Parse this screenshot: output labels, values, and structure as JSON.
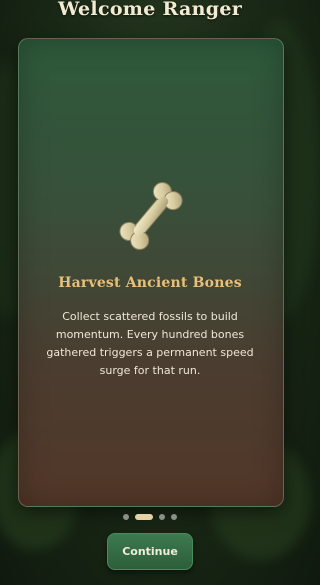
{
  "header": {
    "title": "Welcome Ranger"
  },
  "card": {
    "icon": "bone-icon",
    "title": "Harvest Ancient Bones",
    "description": "Collect scattered fossils to build momentum. Every hundred bones gathered triggers a permanent speed surge for that run."
  },
  "pagination": {
    "total": 4,
    "active_index": 1
  },
  "actions": {
    "continue_label": "Continue"
  },
  "colors": {
    "accent_gold": "#e8c07a",
    "button_green": "#3d7a4e",
    "active_dot": "#e6d1a5"
  }
}
